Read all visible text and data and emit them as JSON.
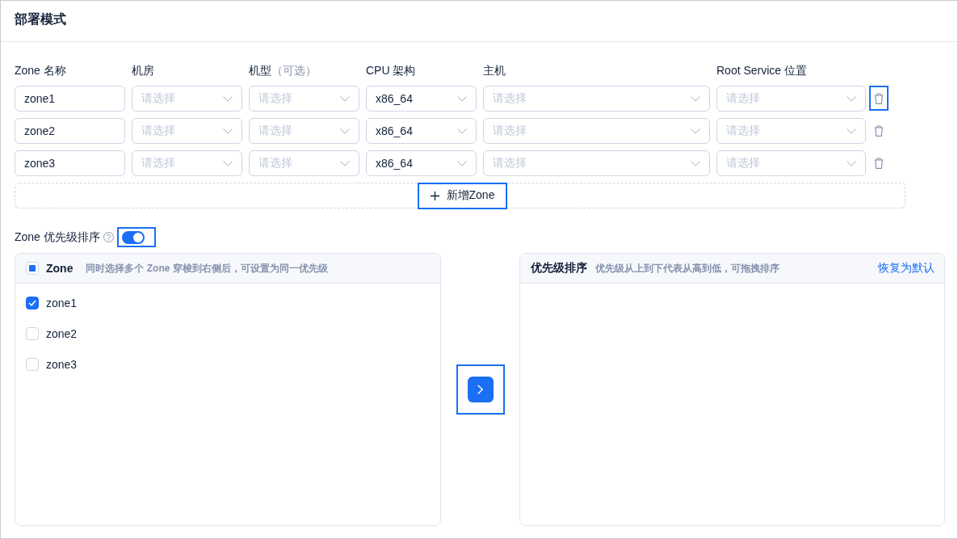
{
  "header": {
    "title": "部署模式"
  },
  "zone_table": {
    "columns": [
      {
        "label": "Zone 名称"
      },
      {
        "label": "机房"
      },
      {
        "label": "机型",
        "note": "（可选）"
      },
      {
        "label": "CPU 架构"
      },
      {
        "label": "主机"
      },
      {
        "label": "Root Service 位置"
      }
    ],
    "rows": [
      {
        "cells": [
          {
            "kind": "input",
            "value": "zone1"
          },
          {
            "kind": "select",
            "placeholder": "请选择"
          },
          {
            "kind": "select",
            "placeholder": "请选择"
          },
          {
            "kind": "select",
            "value": "x86_64"
          },
          {
            "kind": "select",
            "placeholder": "请选择"
          },
          {
            "kind": "select",
            "placeholder": "请选择"
          }
        ],
        "delete_highlighted": true
      },
      {
        "cells": [
          {
            "kind": "input",
            "value": "zone2"
          },
          {
            "kind": "select",
            "placeholder": "请选择"
          },
          {
            "kind": "select",
            "placeholder": "请选择"
          },
          {
            "kind": "select",
            "value": "x86_64"
          },
          {
            "kind": "select",
            "placeholder": "请选择"
          },
          {
            "kind": "select",
            "placeholder": "请选择"
          }
        ],
        "delete_highlighted": false
      },
      {
        "cells": [
          {
            "kind": "input",
            "value": "zone3"
          },
          {
            "kind": "select",
            "placeholder": "请选择"
          },
          {
            "kind": "select",
            "placeholder": "请选择"
          },
          {
            "kind": "select",
            "value": "x86_64"
          },
          {
            "kind": "select",
            "placeholder": "请选择"
          },
          {
            "kind": "select",
            "placeholder": "请选择"
          }
        ],
        "delete_highlighted": false
      }
    ]
  },
  "add_zone_button": {
    "label": "新增Zone",
    "highlighted": true
  },
  "priority_toggle": {
    "label": "Zone 优先级排序",
    "on": true,
    "highlighted": true
  },
  "source_panel": {
    "title": "Zone",
    "hint": "同时选择多个 Zone 穿梭到右侧后，可设置为同一优先级",
    "all_checked": false,
    "partially_checked": true,
    "items": [
      {
        "label": "zone1",
        "checked": true
      },
      {
        "label": "zone2",
        "checked": false
      },
      {
        "label": "zone3",
        "checked": false
      }
    ]
  },
  "transfer_button": {
    "highlighted": true
  },
  "target_panel": {
    "title": "优先级排序",
    "hint": "优先级从上到下代表从高到低，可拖拽排序",
    "reset_link": "恢复为默认"
  }
}
